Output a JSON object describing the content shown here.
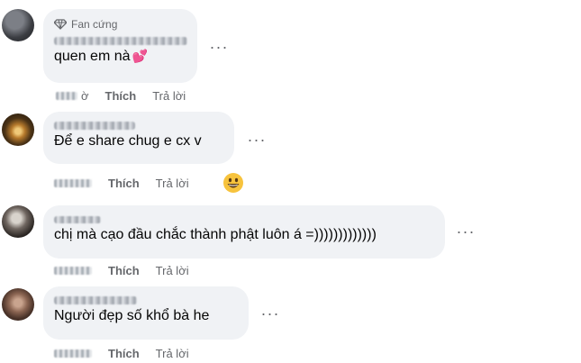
{
  "comments": [
    {
      "badge": "Fan cứng",
      "line1_partial": "... simp ...",
      "text": "quen em nà",
      "reaction_time_visible": "ờ",
      "like_label": "Thích",
      "reply_label": "Trả lời"
    },
    {
      "text": "Để e share chug e cx v",
      "like_label": "Thích",
      "reply_label": "Trả lời"
    },
    {
      "text": "chị mà cạo đầu chắc thành phật luôn á =)))))))))))))",
      "like_label": "Thích",
      "reply_label": "Trả lời"
    },
    {
      "text": "Người đẹp số khổ bà he",
      "like_label": "Thích",
      "reply_label": "Trả lời"
    }
  ],
  "more_label": "···",
  "icons": {
    "badge": "diamond-icon",
    "heart": "heart-emoji",
    "reaction": "grinning-face-emoji",
    "more": "more-options-icon"
  },
  "colors": {
    "bubble": "#f0f2f5",
    "secondary_text": "#65676b",
    "heart": "#e4405f",
    "emoji": "#f7c33d"
  }
}
